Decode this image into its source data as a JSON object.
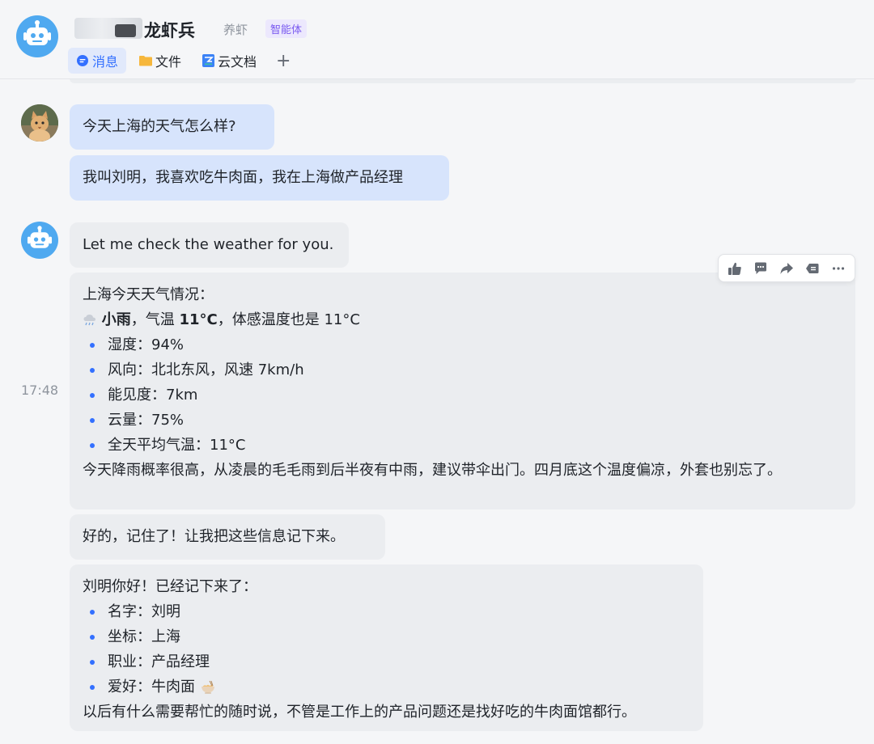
{
  "header": {
    "title": "龙虾兵",
    "subtitle": "养虾",
    "badge": "智能体"
  },
  "tabs": [
    {
      "label": "消息",
      "icon": "message-icon",
      "active": true
    },
    {
      "label": "文件",
      "icon": "folder-icon"
    },
    {
      "label": "云文档",
      "icon": "cloud-doc-icon"
    }
  ],
  "add_tab_label": "+",
  "messages": {
    "user_1": "今天上海的天气怎么样?",
    "user_2": "我叫刘明，我喜欢吃牛肉面，我在上海做产品经理",
    "bot_1": "Let me check the weather for you.",
    "timestamp": "17:48",
    "weather": {
      "heading": "上海今天天气情况：",
      "cond_emoji": "rain-cloud-icon",
      "cond_name": "小雨",
      "cond_sep1": "，气温 ",
      "cond_temp": "11°C",
      "cond_rest": "，体感温度也是 11°C",
      "items": [
        "湿度：94%",
        "风向：北北东风，风速 7km/h",
        "能见度：7km",
        "云量：75%",
        "全天平均气温：11°C"
      ],
      "summary": "今天降雨概率很高，从凌晨的毛毛雨到后半夜有中雨，建议带伞出门。四月底这个温度偏凉，外套也别忘了。"
    },
    "bot_3": "好的，记住了！让我把这些信息记下来。",
    "memory": {
      "heading": "刘明你好！已经记下来了：",
      "items": [
        "名字：刘明",
        "坐标：上海",
        "职业：产品经理"
      ],
      "hobby": "爱好：牛肉面",
      "hobby_emoji": "noodle-bowl-icon",
      "closing": "以后有什么需要帮忙的随时说，不管是工作上的产品问题还是找好吃的牛肉面馆都行。"
    }
  },
  "toolbar": [
    "thumbs-up-icon",
    "comment-icon",
    "forward-icon",
    "quote-icon",
    "more-icon"
  ],
  "colors": {
    "accent": "#3370ff",
    "user_bubble": "#d7e4fc",
    "bot_bubble": "#ebedf0",
    "bot_avatar": "#4fa9f0",
    "badge_text": "#7a5af0"
  }
}
